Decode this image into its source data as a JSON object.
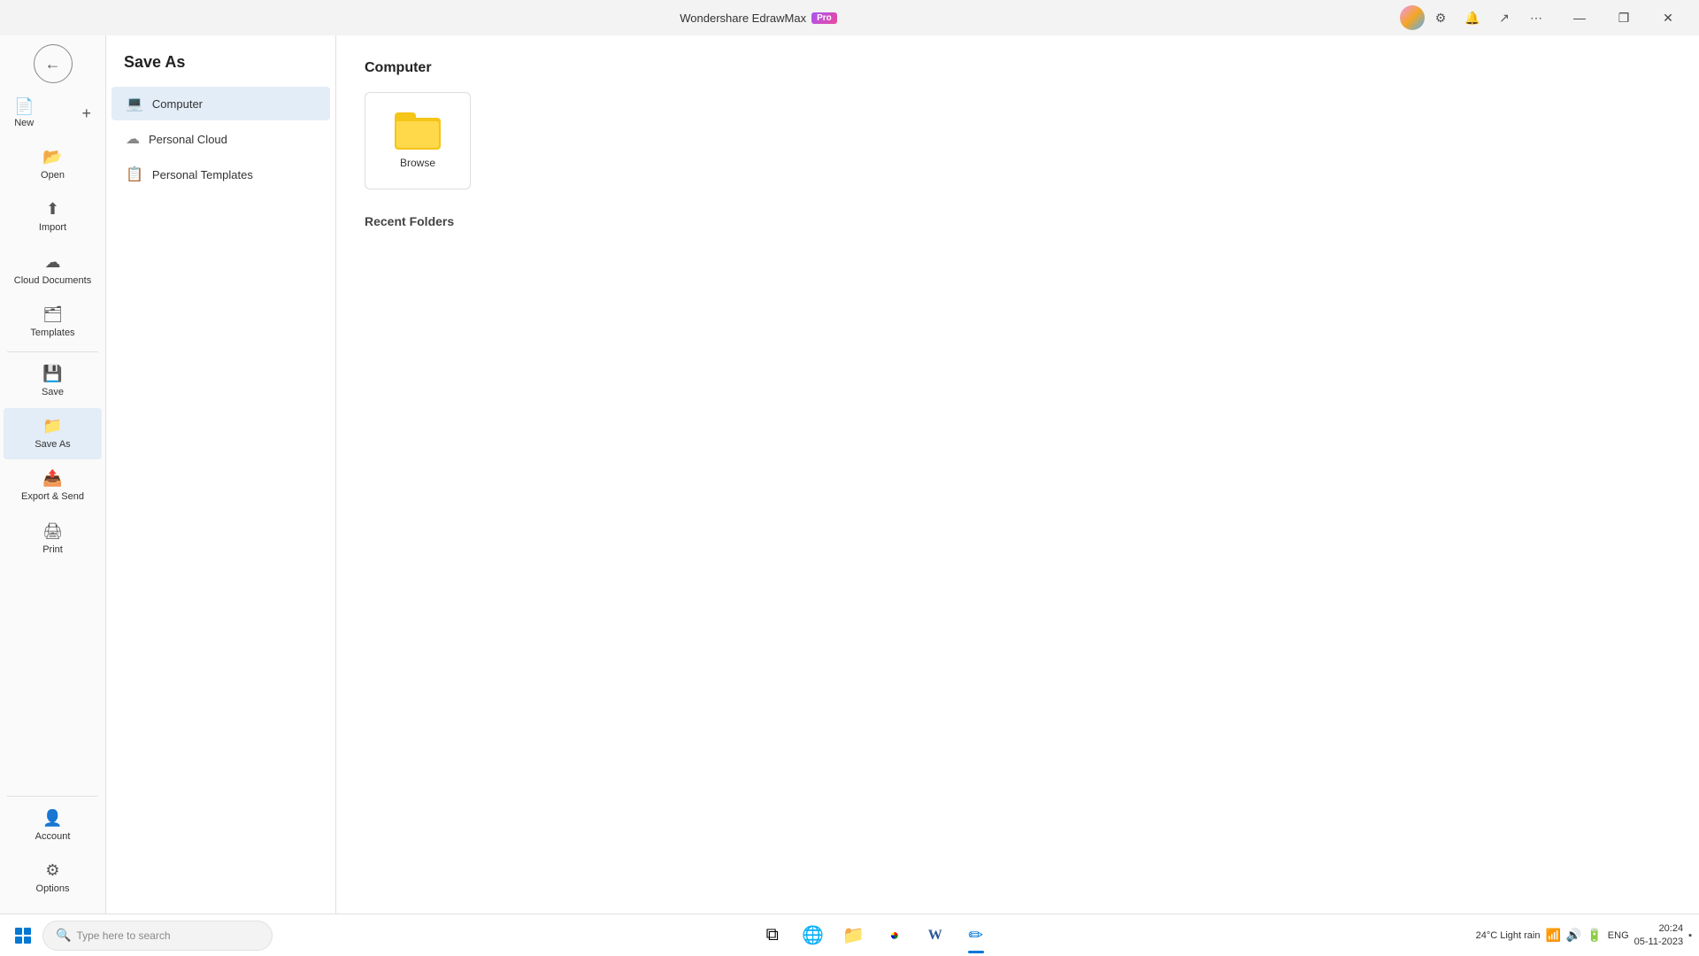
{
  "titlebar": {
    "app_name": "Wondershare EdrawMax",
    "pro_label": "Pro",
    "minimize_label": "—",
    "restore_label": "❐",
    "close_label": "✕"
  },
  "sidebar_narrow": {
    "items": [
      {
        "id": "new",
        "icon": "📄",
        "label": "New",
        "plus": "+"
      },
      {
        "id": "open",
        "icon": "📂",
        "label": "Open"
      },
      {
        "id": "import",
        "icon": "⬆",
        "label": "Import"
      },
      {
        "id": "cloud-documents",
        "icon": "☁",
        "label": "Cloud Documents"
      },
      {
        "id": "templates",
        "icon": "🗂",
        "label": "Templates"
      },
      {
        "id": "save",
        "icon": "💾",
        "label": "Save"
      },
      {
        "id": "save-as",
        "icon": "📁",
        "label": "Save As",
        "active": true
      },
      {
        "id": "export-send",
        "icon": "📤",
        "label": "Export & Send"
      },
      {
        "id": "print",
        "icon": "🖨",
        "label": "Print"
      }
    ],
    "bottom_items": [
      {
        "id": "account",
        "icon": "👤",
        "label": "Account"
      },
      {
        "id": "options",
        "icon": "⚙",
        "label": "Options"
      }
    ]
  },
  "save_as_panel": {
    "title": "Save As",
    "items": [
      {
        "id": "computer",
        "icon": "💻",
        "label": "Computer",
        "active": true
      },
      {
        "id": "personal-cloud",
        "icon": "☁",
        "label": "Personal Cloud"
      },
      {
        "id": "personal-templates",
        "icon": "📋",
        "label": "Personal Templates"
      }
    ]
  },
  "content": {
    "section_title": "Computer",
    "browse_label": "Browse",
    "recent_folders_title": "Recent Folders"
  },
  "taskbar": {
    "search_placeholder": "Type here to search",
    "apps": [
      {
        "id": "start",
        "type": "start"
      },
      {
        "id": "taskview",
        "icon": "⧉"
      },
      {
        "id": "edge",
        "icon": "🌐"
      },
      {
        "id": "explorer",
        "icon": "📁"
      },
      {
        "id": "chrome",
        "icon": "●"
      },
      {
        "id": "word",
        "icon": "W"
      },
      {
        "id": "edrawmax",
        "icon": "✏",
        "active": true
      }
    ],
    "sys": {
      "weather": "24°C  Light rain",
      "lang": "ENG",
      "time": "20:24",
      "date": "05-11-2023"
    }
  }
}
